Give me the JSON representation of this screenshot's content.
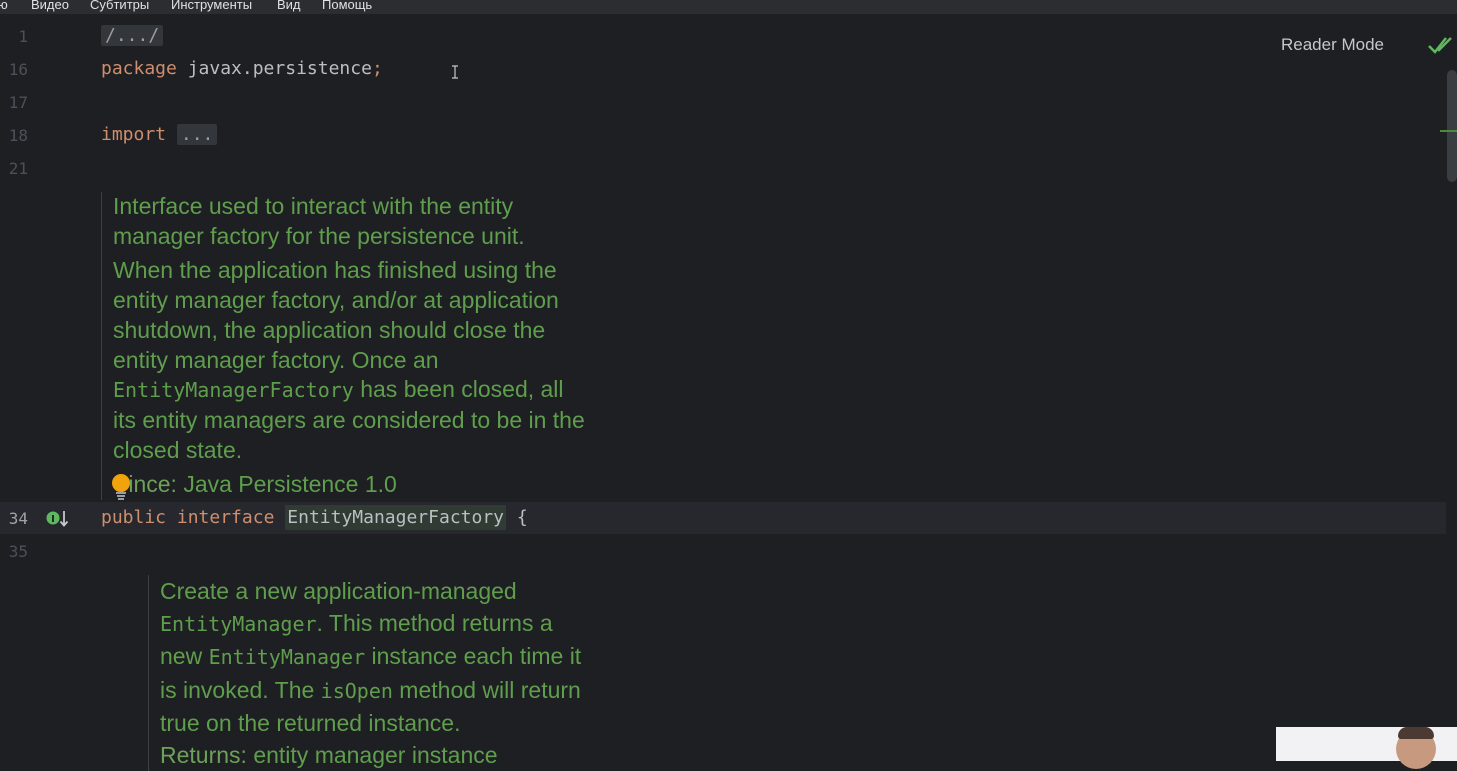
{
  "menu": [
    "ю",
    "Видео",
    "Субтитры",
    "Инструменты",
    "Вид",
    "Помощь"
  ],
  "editor": {
    "reader_mode_label": "Reader Mode",
    "lines": [
      {
        "num": "1",
        "text": "/.../"
      },
      {
        "num": "16",
        "kw": "package",
        "text": " javax.persistence",
        "semi": ";"
      },
      {
        "num": "17"
      },
      {
        "num": "18",
        "kw": "import",
        "fold": "..."
      },
      {
        "num": "21"
      },
      {
        "num": "34",
        "kw1": "public",
        "kw2": "interface",
        "cls": "EntityManagerFactory",
        "brace": " {"
      },
      {
        "num": "35"
      }
    ],
    "doc1": {
      "p1a": "Interface used to interact with the entity",
      "p1b": "manager factory for the persistence unit.",
      "p2a": "When the application has finished using the",
      "p2b": "entity manager factory, and/or at application",
      "p2c": "shutdown, the application should close the",
      "p2d": "entity manager factory. Once an",
      "p2e_code": "EntityManagerFactory",
      "p2e_rest": " has been closed, all",
      "p2f": "its entity managers are considered to be in the",
      "p2g": "closed state.",
      "since_label": "Since:",
      "since_value": " Java Persistence 1.0"
    },
    "doc2": {
      "l1": "Create a new application-managed",
      "l2_code": "EntityManager",
      "l2_rest": ". This method returns a",
      "l3_pre": "new ",
      "l3_code": "EntityManager",
      "l3_rest": " instance each time it",
      "l4_pre": "is invoked. The ",
      "l4_code": "isOpen",
      "l4_rest": " method will return",
      "l5": "true on the returned instance.",
      "returns_label": "Returns:",
      "returns_value": " entity manager instance"
    }
  },
  "colors": {
    "background": "#1e1f22",
    "keyword": "#cf8e6d",
    "doc_text": "#5f9e4d",
    "line_number": "#4b5059",
    "check": "#5fb85f"
  },
  "icons": [
    "check-icon",
    "lightbulb-icon",
    "implemented-interface-icon",
    "text-cursor-icon"
  ]
}
